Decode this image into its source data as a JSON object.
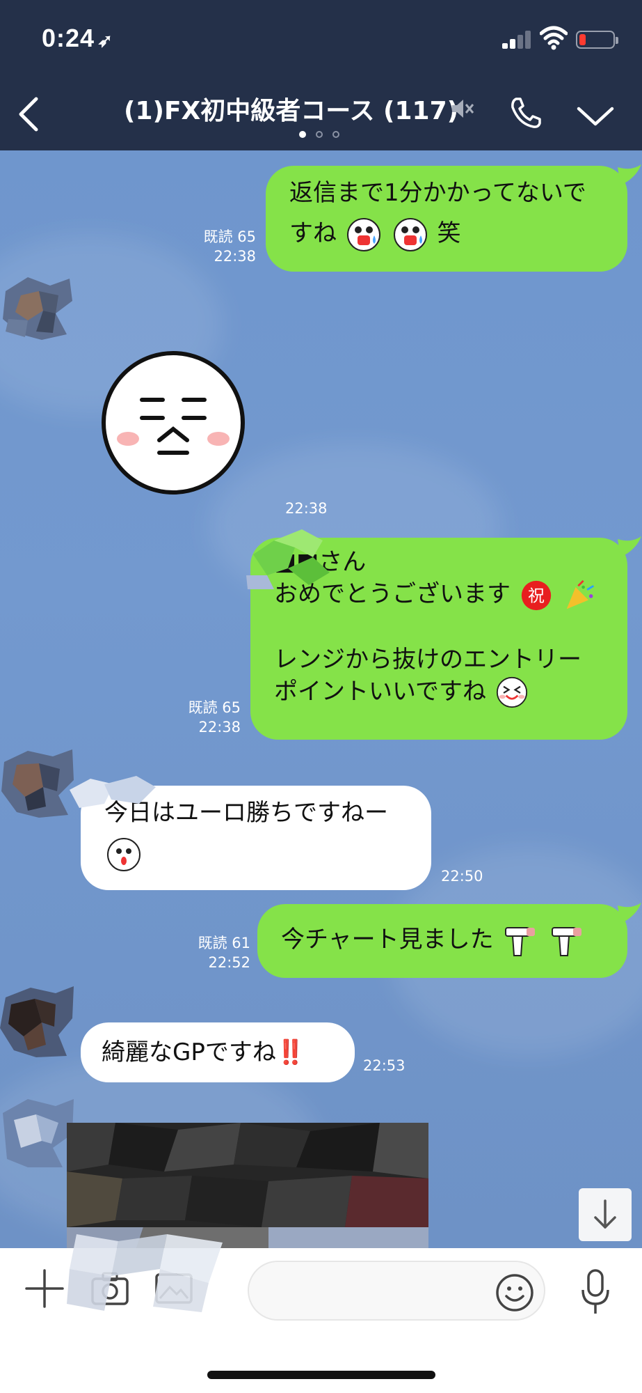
{
  "status_bar": {
    "time": "0:24",
    "location_arrow": "➶"
  },
  "header": {
    "title": "(1)FX初中級者コース (117)",
    "icons": [
      "chevron-left-icon",
      "mute-icon",
      "phone-icon",
      "chevron-down-icon"
    ]
  },
  "messages": [
    {
      "id": "m1",
      "side": "mine",
      "lines": [
        "返信まで1分かかってないで",
        "すね"
      ],
      "suffix": "笑",
      "read": "既読 65",
      "time": "22:38",
      "emojis": [
        "crying-face-emoji",
        "crying-face-emoji"
      ]
    },
    {
      "id": "m2",
      "side": "theirs",
      "type": "sticker",
      "sticker": "sleepy-face-sticker",
      "time": "22:38"
    },
    {
      "id": "m3",
      "side": "mine",
      "lines": [
        "■■さん",
        "おめでとうございます"
      ],
      "lines2": [
        "レンジから抜けのエントリー",
        "ポイントいいですね"
      ],
      "read": "既読 65",
      "time": "22:38",
      "badge": "祝",
      "emojis": [
        "celebration-badge-emoji",
        "party-popper-emoji",
        "grinning-face-emoji"
      ]
    },
    {
      "id": "m4",
      "side": "theirs",
      "lines": [
        "今日はユーロ勝ちですねー"
      ],
      "time": "22:50",
      "emojis": [
        "surprised-face-emoji"
      ]
    },
    {
      "id": "m5",
      "side": "mine",
      "lines": [
        "今チャート見ました"
      ],
      "read": "既読 61",
      "time": "22:52",
      "emojis": [
        "hammer-emoji",
        "hammer-emoji"
      ]
    },
    {
      "id": "m6",
      "side": "theirs",
      "lines": [
        "綺麗なGPですね"
      ],
      "suffix": "‼️",
      "time": "22:53"
    }
  ],
  "composer": {
    "placeholder": "",
    "icons": [
      "plus-icon",
      "camera-icon",
      "photo-icon",
      "emoji-icon",
      "microphone-icon"
    ]
  },
  "colors": {
    "header_bg": "#243049",
    "chat_bg": "#7399cf",
    "my_bubble": "#85e249",
    "their_bubble": "#ffffff",
    "battery_low": "#ff3b30"
  }
}
